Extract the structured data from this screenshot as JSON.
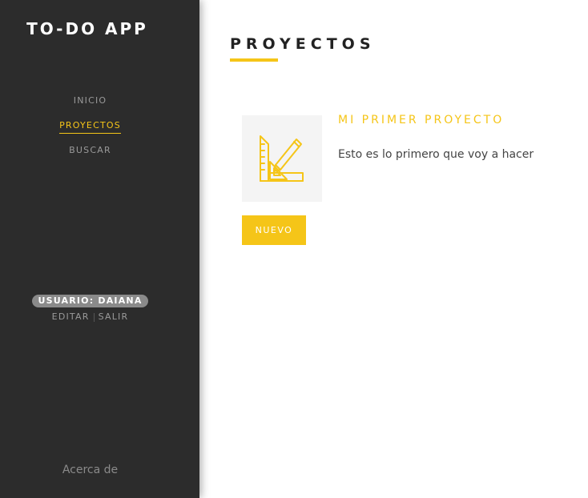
{
  "sidebar": {
    "brand": "TO-DO APP",
    "nav": [
      {
        "label": "INICIO",
        "active": false
      },
      {
        "label": "PROYECTOS",
        "active": true
      },
      {
        "label": "BUSCAR",
        "active": false
      }
    ],
    "user": {
      "badge": "USUARIO: DAIANA",
      "edit_label": "EDITAR",
      "logout_label": "SALIR"
    },
    "about_label": "Acerca de"
  },
  "main": {
    "title": "PROYECTOS",
    "project": {
      "title": "MI PRIMER PROYECTO",
      "description": "Esto es lo primero que voy a hacer",
      "thumbnail_icon": "ruler-pencil-icon"
    },
    "new_button_label": "NUEVO"
  },
  "colors": {
    "accent": "#f5c518",
    "sidebar_bg": "#2c2c2c",
    "badge_bg": "#8a8a8a"
  }
}
